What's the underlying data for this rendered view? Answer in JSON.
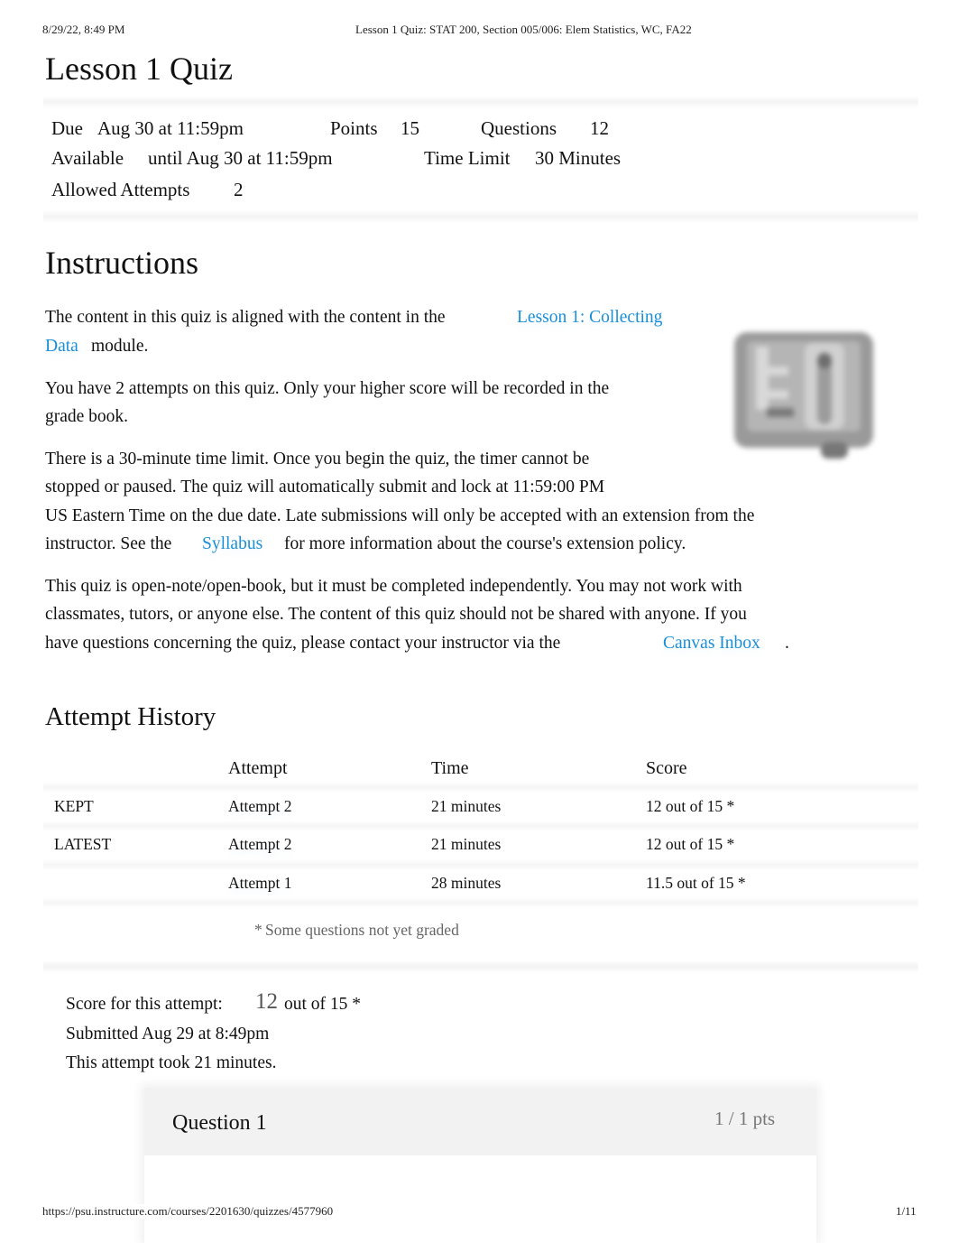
{
  "print_header": {
    "datetime": "8/29/22, 8:49 PM",
    "page_title": "Lesson 1 Quiz: STAT 200, Section 005/006: Elem Statistics, WC, FA22"
  },
  "quiz": {
    "title": "Lesson 1 Quiz",
    "details": {
      "due_label": "Due",
      "due_value": "Aug 30 at 11:59pm",
      "points_label": "Points",
      "points_value": "15",
      "questions_label": "Questions",
      "questions_value": "12",
      "available_label": "Available",
      "available_value": "until Aug 30 at 11:59pm",
      "time_limit_label": "Time Limit",
      "time_limit_value": "30 Minutes",
      "attempts_label": "Allowed Attempts",
      "attempts_value": "2"
    }
  },
  "instructions": {
    "heading": "Instructions",
    "p1_before": "The content in this quiz is aligned with the content in the",
    "p1_link_line1": "Lesson 1: Collecting",
    "p1_link_line2": "Data",
    "p1_after": "module.",
    "p2_line1": "You have 2 attempts on this quiz. Only your higher score will be recorded in the",
    "p2_line2": "grade book.",
    "p3_line1": "There is a 30-minute time limit. Once you begin the quiz, the timer cannot be",
    "p3_line2": "stopped or paused. The quiz will automatically submit and lock at 11:59:00 PM",
    "p3_line3": "US Eastern Time on the due date. Late submissions will only be accepted with an extension from the",
    "p3_line4_before": "instructor. See the",
    "p3_link": "Syllabus",
    "p3_line4_after": "for more information about the course's extension policy.",
    "p4_line1": "This quiz is open-note/open-book, but it must be completed independently. You may not work with",
    "p4_line2": "classmates, tutors, or anyone else. The content of this quiz should not be shared with anyone. If you",
    "p4_line3_before": "have questions concerning the quiz, please contact your instructor via the",
    "p4_link": "Canvas Inbox",
    "p4_line3_after": ".",
    "image_icon": "book-icon"
  },
  "attempt_history": {
    "heading": "Attempt History",
    "columns": [
      "",
      "Attempt",
      "Time",
      "Score"
    ],
    "rows": [
      {
        "status": "KEPT",
        "attempt": "Attempt 2",
        "time": "21 minutes",
        "score": "12 out of 15 *"
      },
      {
        "status": "LATEST",
        "attempt": "Attempt 2",
        "time": "21 minutes",
        "score": "12 out of 15 *"
      },
      {
        "status": "",
        "attempt": "Attempt 1",
        "time": "28 minutes",
        "score": "11.5 out of 15 *"
      }
    ],
    "footnote_mark": "*",
    "footnote": "Some questions not yet graded"
  },
  "attempt_summary": {
    "score_label": "Score for this attempt:",
    "score_value": "12",
    "score_suffix": "out of 15 *",
    "submitted": "Submitted Aug 29 at 8:49pm",
    "duration": "This attempt took 21 minutes."
  },
  "question": {
    "name": "Question 1",
    "points": "1 / 1 pts"
  },
  "print_footer": {
    "url": "https://psu.instructure.com/courses/2201630/quizzes/4577960",
    "page": "1/11"
  }
}
